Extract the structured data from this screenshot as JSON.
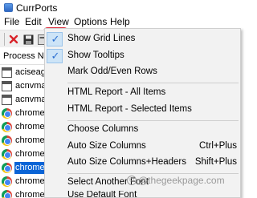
{
  "window": {
    "title": "CurrPorts"
  },
  "menubar": {
    "items": [
      "File",
      "Edit",
      "View",
      "Options",
      "Help"
    ]
  },
  "toolbar": {
    "delete_icon": "x-icon",
    "save_icon": "save-icon",
    "more_icon": "toolbar-icon"
  },
  "list": {
    "header": "Process Na",
    "rows": [
      {
        "label": "aciseage",
        "icon": "console-icon"
      },
      {
        "label": "acnvmag",
        "icon": "console-icon"
      },
      {
        "label": "acnvmag",
        "icon": "console-icon"
      },
      {
        "label": "chrome.",
        "icon": "chrome-icon"
      },
      {
        "label": "chrome.",
        "icon": "chrome-icon"
      },
      {
        "label": "chrome.",
        "icon": "chrome-icon"
      },
      {
        "label": "chrome.",
        "icon": "chrome-icon"
      },
      {
        "label": "chrome.",
        "icon": "chrome-icon",
        "selected": true
      },
      {
        "label": "chrome.",
        "icon": "chrome-icon"
      },
      {
        "label": "chrome.",
        "icon": "chrome-icon"
      },
      {
        "label": "chrome.",
        "icon": "chrome-icon"
      },
      {
        "label": "chrome.",
        "icon": "chrome-icon"
      }
    ]
  },
  "view_menu": {
    "items": [
      {
        "label": "Show Grid Lines",
        "checked": true
      },
      {
        "label": "Show Tooltips",
        "checked": true
      },
      {
        "label": "Mark Odd/Even Rows"
      },
      {
        "separator": true
      },
      {
        "label": "HTML Report - All Items"
      },
      {
        "label": "HTML Report - Selected Items"
      },
      {
        "separator": true
      },
      {
        "label": "Choose Columns"
      },
      {
        "label": "Auto Size Columns",
        "shortcut": "Ctrl+Plus"
      },
      {
        "label": "Auto Size Columns+Headers",
        "shortcut": "Shift+Plus"
      },
      {
        "separator": true
      },
      {
        "label": "Select Another Font"
      },
      {
        "label": "Use Default Font"
      }
    ]
  },
  "watermark": {
    "text": "@thegeekpage.com"
  },
  "colors": {
    "selection": "#0a64d6",
    "highlight_outline": "#e0303f",
    "menu_bg": "#f2f2f2"
  }
}
